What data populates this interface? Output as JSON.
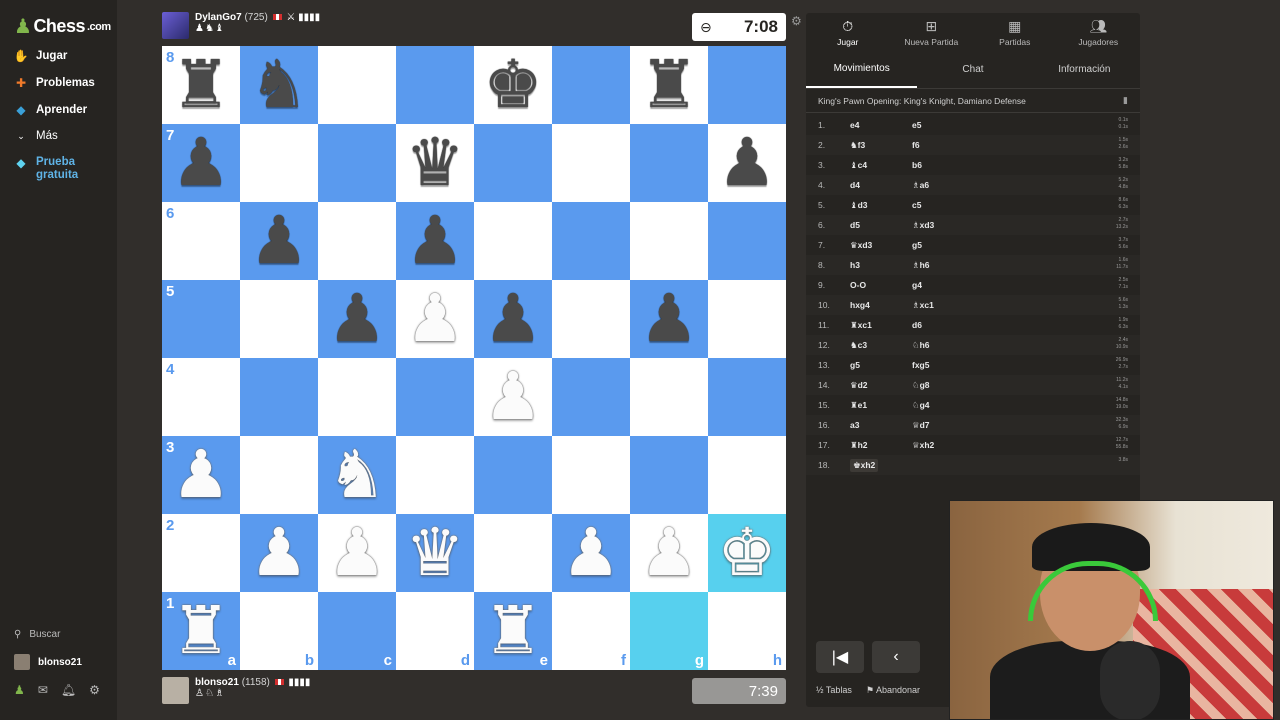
{
  "sidebar": {
    "logo_text": "Chess",
    "logo_suffix": ".com",
    "items": [
      {
        "label": "Jugar",
        "icon": "play-hand-icon"
      },
      {
        "label": "Problemas",
        "icon": "puzzle-icon"
      },
      {
        "label": "Aprender",
        "icon": "learn-cap-icon"
      },
      {
        "label": "Más",
        "icon": "chevron-down-icon"
      }
    ],
    "trial": {
      "line1": "Prueba",
      "line2": "gratuita",
      "icon": "diamond-icon"
    },
    "search_label": "Buscar",
    "username": "blonso21"
  },
  "top_player": {
    "name": "DylanGo7",
    "rating": "(725)",
    "captured": "♟♞♝"
  },
  "bottom_player": {
    "name": "blonso21",
    "rating": "(1158)",
    "captured": "♙♘♗"
  },
  "clocks": {
    "top": "7:08",
    "bottom": "7:39"
  },
  "board": {
    "files": [
      "a",
      "b",
      "c",
      "d",
      "e",
      "f",
      "g",
      "h"
    ],
    "ranks": [
      "8",
      "7",
      "6",
      "5",
      "4",
      "3",
      "2",
      "1"
    ],
    "rows": [
      [
        "r",
        "n",
        "",
        "",
        "k",
        "",
        "r",
        ""
      ],
      [
        "p",
        "",
        "",
        "q",
        "",
        "",
        "",
        "p"
      ],
      [
        "",
        "p",
        "",
        "p",
        "",
        "",
        "",
        ""
      ],
      [
        "",
        "",
        "p",
        "P",
        "p",
        "",
        "p",
        ""
      ],
      [
        "",
        "",
        "",
        "",
        "P",
        "",
        "",
        ""
      ],
      [
        "P",
        "",
        "N",
        "",
        "",
        "",
        "",
        ""
      ],
      [
        "",
        "P",
        "P",
        "Q",
        "",
        "P",
        "P",
        "K"
      ],
      [
        "R",
        "",
        "",
        "",
        "R",
        "",
        "",
        ""
      ]
    ],
    "highlight": [
      "g1",
      "h2"
    ],
    "colors": {
      "light": "#ffffff",
      "dark": "#5a9aee",
      "highlight": "#57d0ee"
    }
  },
  "panel": {
    "tabs": [
      {
        "label": "Jugar",
        "icon": "stopwatch-icon",
        "active": true
      },
      {
        "label": "Nueva Partida",
        "icon": "plus-square-icon",
        "active": false
      },
      {
        "label": "Partidas",
        "icon": "board-icon",
        "active": false
      },
      {
        "label": "Jugadores",
        "icon": "users-icon",
        "active": false
      }
    ],
    "subtabs": [
      {
        "label": "Movimientos",
        "active": true
      },
      {
        "label": "Chat",
        "active": false
      },
      {
        "label": "Información",
        "active": false
      }
    ],
    "opening": "King's Pawn Opening: King's Knight, Damiano Defense",
    "moves": [
      {
        "n": "1.",
        "w": "e4",
        "b": "e5",
        "tw": "0.1s",
        "tb": "0.1s"
      },
      {
        "n": "2.",
        "w": "♞f3",
        "b": "f6",
        "tw": "1.5s",
        "tb": "2.6s"
      },
      {
        "n": "3.",
        "w": "♝c4",
        "b": "b6",
        "tw": "3.2s",
        "tb": "5.8s"
      },
      {
        "n": "4.",
        "w": "d4",
        "b": "♗a6",
        "tw": "5.2s",
        "tb": "4.8s"
      },
      {
        "n": "5.",
        "w": "♝d3",
        "b": "c5",
        "tw": "8.6s",
        "tb": "6.3s"
      },
      {
        "n": "6.",
        "w": "d5",
        "b": "♗xd3",
        "tw": "2.7s",
        "tb": "13.2s"
      },
      {
        "n": "7.",
        "w": "♛xd3",
        "b": "g5",
        "tw": "3.7s",
        "tb": "5.6s"
      },
      {
        "n": "8.",
        "w": "h3",
        "b": "♗h6",
        "tw": "1.6s",
        "tb": "11.7s"
      },
      {
        "n": "9.",
        "w": "O-O",
        "b": "g4",
        "tw": "2.5s",
        "tb": "7.1s"
      },
      {
        "n": "10.",
        "w": "hxg4",
        "b": "♗xc1",
        "tw": "5.6s",
        "tb": "1.3s"
      },
      {
        "n": "11.",
        "w": "♜xc1",
        "b": "d6",
        "tw": "1.9s",
        "tb": "6.3s"
      },
      {
        "n": "12.",
        "w": "♞c3",
        "b": "♘h6",
        "tw": "2.4s",
        "tb": "10.9s"
      },
      {
        "n": "13.",
        "w": "g5",
        "b": "fxg5",
        "tw": "26.9s",
        "tb": "2.7s"
      },
      {
        "n": "14.",
        "w": "♛d2",
        "b": "♘g8",
        "tw": "11.2s",
        "tb": "4.1s"
      },
      {
        "n": "15.",
        "w": "♜e1",
        "b": "♘g4",
        "tw": "14.8s",
        "tb": "19.0s"
      },
      {
        "n": "16.",
        "w": "a3",
        "b": "♕d7",
        "tw": "32.3s",
        "tb": "6.9s"
      },
      {
        "n": "17.",
        "w": "♜h2",
        "b": "♕xh2",
        "tw": "12.7s",
        "tb": "55.8s"
      },
      {
        "n": "18.",
        "w": "♚xh2",
        "b": "",
        "tw": "3.8s",
        "tb": ""
      }
    ],
    "actions": {
      "draw": "Tablas",
      "resign": "Abandonar"
    }
  }
}
